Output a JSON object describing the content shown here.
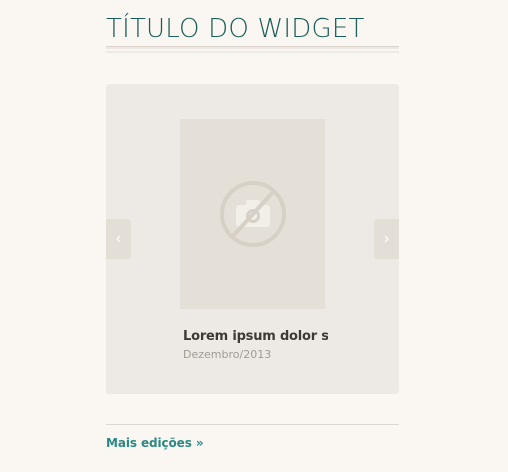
{
  "widget": {
    "title": "TÍTULO DO WIDGET"
  },
  "carousel": {
    "prev_icon": "chevron-left-icon",
    "prev_glyph": "‹",
    "next_icon": "chevron-right-icon",
    "next_glyph": "›",
    "cover_placeholder_icon": "no-camera-icon",
    "item": {
      "title": "Lorem ipsum dolor s...",
      "date": "Dezembro/2013"
    }
  },
  "footer": {
    "more_link": "Mais edições »"
  },
  "colors": {
    "title": "#1c5e58",
    "link": "#2a8a83",
    "background": "#faf6f1",
    "panel": "#edeae5",
    "placeholder": "#e5e0d7"
  }
}
